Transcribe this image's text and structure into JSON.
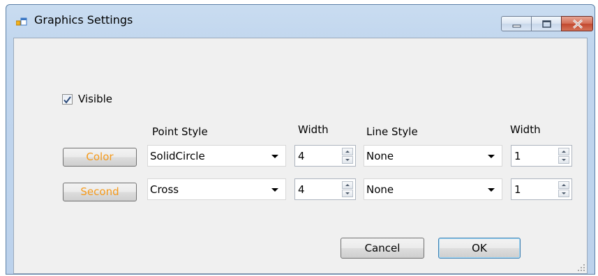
{
  "window": {
    "title": "Graphics Settings"
  },
  "title_controls": [
    "minimize",
    "maximize",
    "close"
  ],
  "visible": {
    "label": "Visible",
    "checked": true
  },
  "headers": {
    "point_style": "Point Style",
    "width1": "Width",
    "line_style": "Line Style",
    "width2": "Width"
  },
  "rows": [
    {
      "button": "Color",
      "point_style": "SolidCircle",
      "point_width": "4",
      "line_style": "None",
      "line_width": "1"
    },
    {
      "button": "Second",
      "point_style": "Cross",
      "point_width": "4",
      "line_style": "None",
      "line_width": "1"
    }
  ],
  "buttons": {
    "cancel": "Cancel",
    "ok": "OK"
  },
  "colors": {
    "color_button_text": "#f59a1b",
    "title_bar": "#c1d6ee",
    "client_bg": "#f0f0f0"
  }
}
